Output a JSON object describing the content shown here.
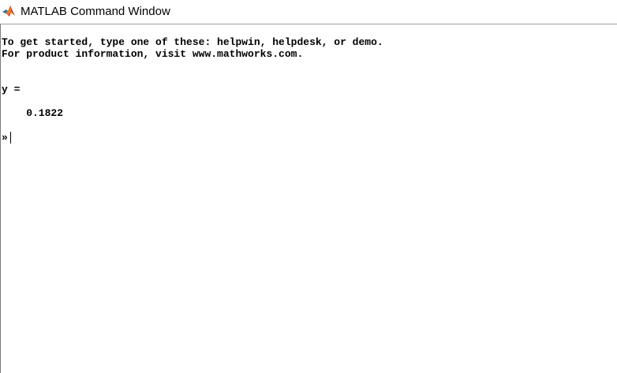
{
  "window": {
    "title": "MATLAB Command Window",
    "icon": "matlab-logo-icon"
  },
  "console": {
    "lines": [
      "To get started, type one of these: helpwin, helpdesk, or demo.",
      "For product information, visit www.mathworks.com.",
      "",
      "",
      "y =",
      "",
      "    0.1822",
      ""
    ],
    "prompt": "»"
  },
  "colors": {
    "background": "#ffffff",
    "text": "#000000",
    "logo_orange": "#e2772b",
    "logo_red": "#b22d1c"
  }
}
